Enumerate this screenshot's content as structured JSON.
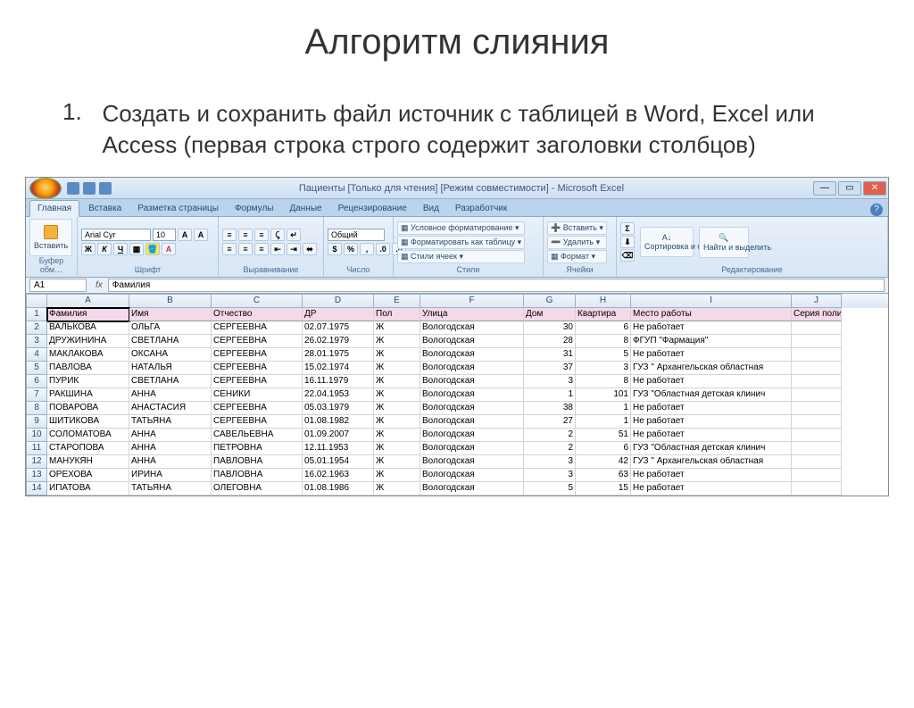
{
  "slide": {
    "title": "Алгоритм слияния",
    "list_number": "1.",
    "list_text": "Создать и сохранить файл источник  с таблицей в Word, Excel или Access (первая строка строго содержит заголовки столбцов)"
  },
  "excel": {
    "window_title": "Пациенты  [Только для чтения]  [Режим совместимости] - Microsoft Excel",
    "tabs": [
      "Главная",
      "Вставка",
      "Разметка страницы",
      "Формулы",
      "Данные",
      "Рецензирование",
      "Вид",
      "Разработчик"
    ],
    "ribbon": {
      "paste": "Вставить",
      "clipboard_label": "Буфер обм…",
      "font_name": "Arial Cyr",
      "font_size": "10",
      "font_label": "Шрифт",
      "align_label": "Выравнивание",
      "number_format": "Общий",
      "number_label": "Число",
      "cond_format": "Условное форматирование",
      "as_table": "Форматировать как таблицу",
      "cell_styles": "Стили ячеек",
      "styles_label": "Стили",
      "insert": "Вставить",
      "delete": "Удалить",
      "format": "Формат",
      "cells_label": "Ячейки",
      "sort_filter": "Сортировка и фильтр",
      "find_select": "Найти и выделить",
      "edit_label": "Редактирование"
    },
    "name_box": "A1",
    "formula_value": "Фамилия",
    "columns": [
      "A",
      "B",
      "C",
      "D",
      "E",
      "F",
      "G",
      "H",
      "I",
      "J"
    ],
    "headers": [
      "Фамилия",
      "Имя",
      "Отчество",
      "ДР",
      "Пол",
      "Улица",
      "Дом",
      "Квартира",
      "Место работы",
      "Серия полис"
    ],
    "rows": [
      [
        "ВАЛЬКОВА",
        "ОЛЬГА",
        "СЕРГЕЕВНА",
        "02.07.1975",
        "Ж",
        "Вологодская",
        "30",
        "6",
        "Не работает",
        ""
      ],
      [
        "ДРУЖИНИНА",
        "СВЕТЛАНА",
        "СЕРГЕЕВНА",
        "26.02.1979",
        "Ж",
        "Вологодская",
        "28",
        "8",
        "ФГУП \"Фармация\"",
        ""
      ],
      [
        "МАКЛАКОВА",
        "ОКСАНА",
        "СЕРГЕЕВНА",
        "28.01.1975",
        "Ж",
        "Вологодская",
        "31",
        "5",
        "Не работает",
        ""
      ],
      [
        "ПАВЛОВА",
        "НАТАЛЬЯ",
        "СЕРГЕЕВНА",
        "15.02.1974",
        "Ж",
        "Вологодская",
        "37",
        "3",
        "ГУЗ \" Архангельская областная",
        ""
      ],
      [
        "ПУРИК",
        "СВЕТЛАНА",
        "СЕРГЕЕВНА",
        "16.11.1979",
        "Ж",
        "Вологодская",
        "3",
        "8",
        "Не работает",
        ""
      ],
      [
        "РАКШИНА",
        "АННА",
        "СЕНИКИ",
        "22.04.1953",
        "Ж",
        "Вологодская",
        "1",
        "101",
        "ГУЗ \"Областная детская клинич",
        ""
      ],
      [
        "ПОВАРОВА",
        "АНАСТАСИЯ",
        "СЕРГЕЕВНА",
        "05.03.1979",
        "Ж",
        "Вологодская",
        "38",
        "1",
        "Не работает",
        ""
      ],
      [
        "ШИТИКОВА",
        "ТАТЬЯНА",
        "СЕРГЕЕВНА",
        "01.08.1982",
        "Ж",
        "Вологодская",
        "27",
        "1",
        "Не работает",
        ""
      ],
      [
        "СОЛОМАТОВА",
        "АННА",
        "САВЕЛЬЕВНА",
        "01.09.2007",
        "Ж",
        "Вологодская",
        "2",
        "51",
        "Не работает",
        ""
      ],
      [
        "СТАРОПОВА",
        "АННА",
        "ПЕТРОВНА",
        "12.11.1953",
        "Ж",
        "Вологодская",
        "2",
        "6",
        "ГУЗ \"Областная детская клинич",
        ""
      ],
      [
        "МАНУКЯН",
        "АННА",
        "ПАВЛОВНА",
        "05.01.1954",
        "Ж",
        "Вологодская",
        "3",
        "42",
        "ГУЗ \" Архангельская областная",
        ""
      ],
      [
        "ОРЕХОВА",
        "ИРИНА",
        "ПАВЛОВНА",
        "16.02.1963",
        "Ж",
        "Вологодская",
        "3",
        "63",
        "Не работает",
        ""
      ],
      [
        "ИПАТОВА",
        "ТАТЬЯНА",
        "ОЛЕГОВНА",
        "01.08.1986",
        "Ж",
        "Вологодская",
        "5",
        "15",
        "Не работает",
        ""
      ]
    ]
  }
}
